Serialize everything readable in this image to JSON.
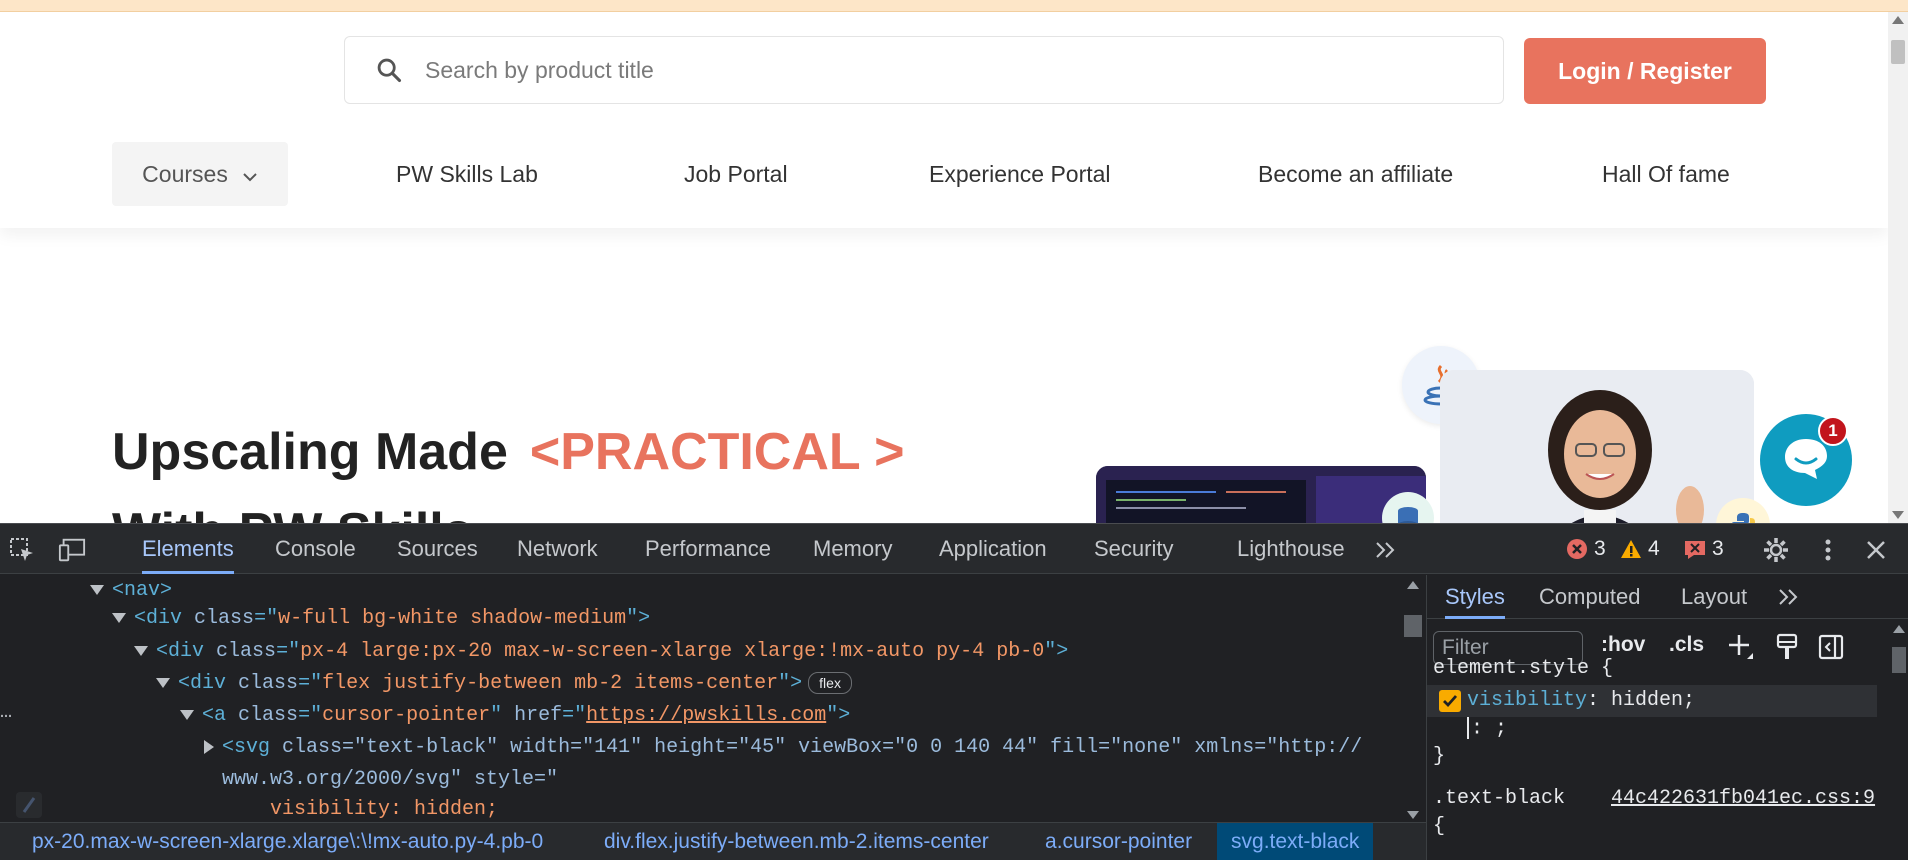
{
  "site": {
    "search_placeholder": "Search by product title",
    "login_label": "Login / Register",
    "nav": {
      "courses": "Courses",
      "items": [
        "PW Skills Lab",
        "Job Portal",
        "Experience Portal",
        "Become an affiliate",
        "Hall Of fame"
      ]
    },
    "hero": {
      "title": "Upscaling Made",
      "accent": "<PRACTICAL >",
      "line2": "With PW Skills"
    },
    "chat_badge": "1",
    "colors": {
      "accent": "#e8735e",
      "chat": "#0f9cc0",
      "banner": "#fde6c8"
    }
  },
  "devtools": {
    "tabs": [
      "Elements",
      "Console",
      "Sources",
      "Network",
      "Performance",
      "Memory",
      "Application",
      "Security",
      "Lighthouse"
    ],
    "active_tab": "Elements",
    "counters": {
      "errors": "3",
      "warnings": "4",
      "issues": "3"
    },
    "elements": {
      "lines": [
        {
          "tag_open": "<nav>"
        },
        {
          "tag": "div",
          "attr": "class",
          "value": "w-full bg-white shadow-medium"
        },
        {
          "tag": "div",
          "attr": "class",
          "value": "px-4 large:px-20 max-w-screen-xlarge xlarge:!mx-auto py-4 pb-0"
        },
        {
          "tag": "div",
          "attr": "class",
          "value": "flex justify-between mb-2 items-center",
          "badge": "flex"
        },
        {
          "tag": "a",
          "attr1": "class",
          "value1": "cursor-pointer",
          "attr2": "href",
          "value2": "https://pwskills.com"
        },
        {
          "tag": "svg",
          "text": "class=\"text-black\" width=\"141\" height=\"45\" viewBox=\"0 0 140 44\" fill=\"none\" xmlns=\"http://",
          "cont": "www.w3.org/2000/svg\" style=\"",
          "cont2": "visibility: hidden;"
        }
      ]
    },
    "breadcrumbs": [
      {
        "tag": "",
        "cls": "px-20.max-w-screen-xlarge.xlarge\\:\\!mx-auto.py-4.pb-0"
      },
      {
        "tag": "div",
        "cls": ".flex.justify-between.mb-2.items-center"
      },
      {
        "tag": "a",
        "cls": ".cursor-pointer"
      },
      {
        "tag": "svg",
        "cls": ".text-black"
      }
    ],
    "styles": {
      "tabs": [
        "Styles",
        "Computed",
        "Layout"
      ],
      "filter_placeholder": "Filter",
      "hov": ":hov",
      "cls": ".cls",
      "element_style": "element.style {",
      "prop": "visibility",
      "value": "hidden;",
      "empty_decl": ": ;",
      "close": "}",
      "rule_selector": ".text-black",
      "rule_source": "44c422631fb041ec.css:9",
      "rule_open": "{"
    }
  }
}
